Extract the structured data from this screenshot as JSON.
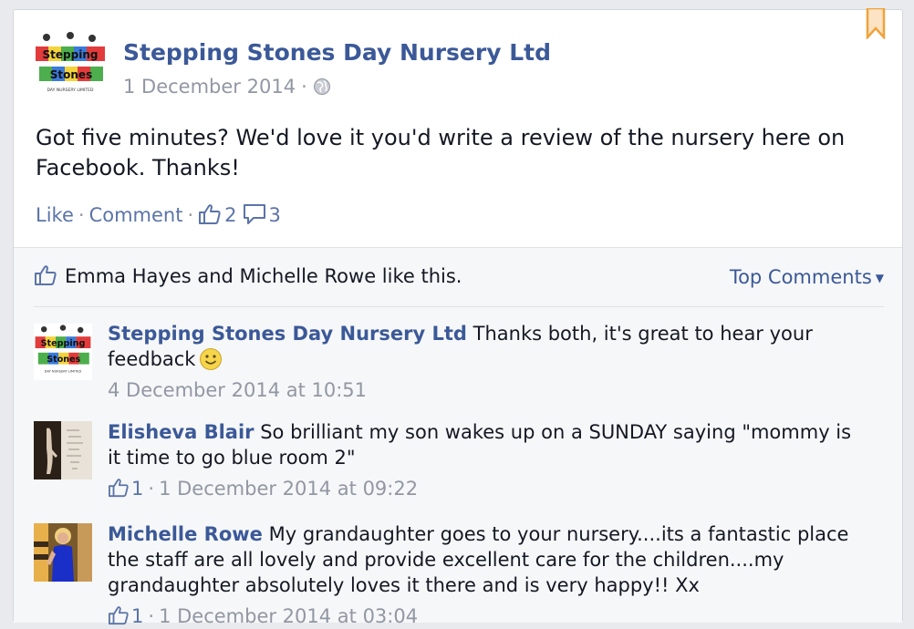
{
  "post": {
    "page_name": "Stepping Stones Day Nursery Ltd",
    "date": "1 December 2014",
    "meta_sep": "·",
    "text": "Got five minutes? We'd love it you'd write a review of the nursery here on Facebook. Thanks!",
    "actions": {
      "like": "Like",
      "comment": "Comment",
      "sep": "·",
      "like_count": "2",
      "comment_count": "3"
    },
    "logo": {
      "line1": "Stepping",
      "line2": "Stones",
      "tagline": "DAY NURSERY LIMITED"
    }
  },
  "ufi": {
    "likes_text": "Emma Hayes and Michelle Rowe like this.",
    "sort_label": "Top Comments",
    "sort_caret": "▼"
  },
  "comments": [
    {
      "author": "Stepping Stones Day Nursery Ltd",
      "text": " Thanks both, it's great to hear your feedback",
      "timestamp": "4 December 2014 at 10:51",
      "likes": ""
    },
    {
      "author": "Elisheva Blair",
      "text": " So brilliant my son wakes up on a SUNDAY saying \"mommy is it time to go blue room 2\"",
      "timestamp": "1 December 2014 at 09:22",
      "likes": "1"
    },
    {
      "author": "Michelle Rowe",
      "text": " My grandaughter goes to your nursery....its a fantastic place the staff are all lovely and provide excellent care for the children....my grandaughter absolutely loves it there and is very happy!! Xx",
      "timestamp": "1 December 2014 at 03:04",
      "likes": "1"
    }
  ],
  "meta_sep": "·",
  "colors": {
    "link": "#3b5998",
    "muted": "#9197a3",
    "bookmark": "#f0a23c"
  }
}
